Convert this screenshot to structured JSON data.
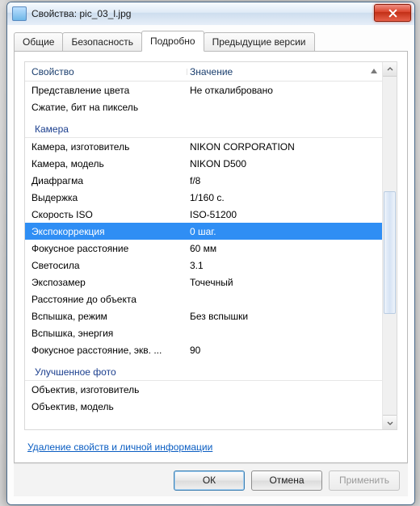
{
  "window": {
    "title": "Свойства: pic_03_l.jpg"
  },
  "tabs": {
    "general": "Общие",
    "security": "Безопасность",
    "details": "Подробно",
    "previous": "Предыдущие версии"
  },
  "columns": {
    "property": "Свойство",
    "value": "Значение"
  },
  "rows": {
    "colorRep": {
      "k": "Представление цвета",
      "v": "Не откалибровано"
    },
    "compression": {
      "k": "Сжатие, бит на пиксель",
      "v": ""
    },
    "grpCamera": {
      "k": "Камера"
    },
    "camMaker": {
      "k": "Камера, изготовитель",
      "v": "NIKON CORPORATION"
    },
    "camModel": {
      "k": "Камера, модель",
      "v": "NIKON D500"
    },
    "aperture": {
      "k": "Диафрагма",
      "v": "f/8"
    },
    "exposure": {
      "k": "Выдержка",
      "v": "1/160 с."
    },
    "iso": {
      "k": "Скорость ISO",
      "v": "ISO-51200"
    },
    "expoBias": {
      "k": "Экспокоррекция",
      "v": "0 шаг."
    },
    "focal": {
      "k": "Фокусное расстояние",
      "v": "60 мм"
    },
    "fnumber": {
      "k": "Светосила",
      "v": "3.1"
    },
    "metering": {
      "k": "Экспозамер",
      "v": "Точечный"
    },
    "distance": {
      "k": "Расстояние до объекта",
      "v": ""
    },
    "flashMode": {
      "k": "Вспышка, режим",
      "v": "Без вспышки"
    },
    "flashEnergy": {
      "k": "Вспышка, энергия",
      "v": ""
    },
    "focal35": {
      "k": "Фокусное расстояние, экв. ...",
      "v": "90"
    },
    "grpAdvanced": {
      "k": "Улучшенное фото"
    },
    "lensMaker": {
      "k": "Объектив, изготовитель",
      "v": ""
    },
    "lensModel": {
      "k": "Объектив, модель",
      "v": ""
    }
  },
  "link": "Удаление свойств и личной информации",
  "buttons": {
    "ok": "ОК",
    "cancel": "Отмена",
    "apply": "Применить"
  }
}
